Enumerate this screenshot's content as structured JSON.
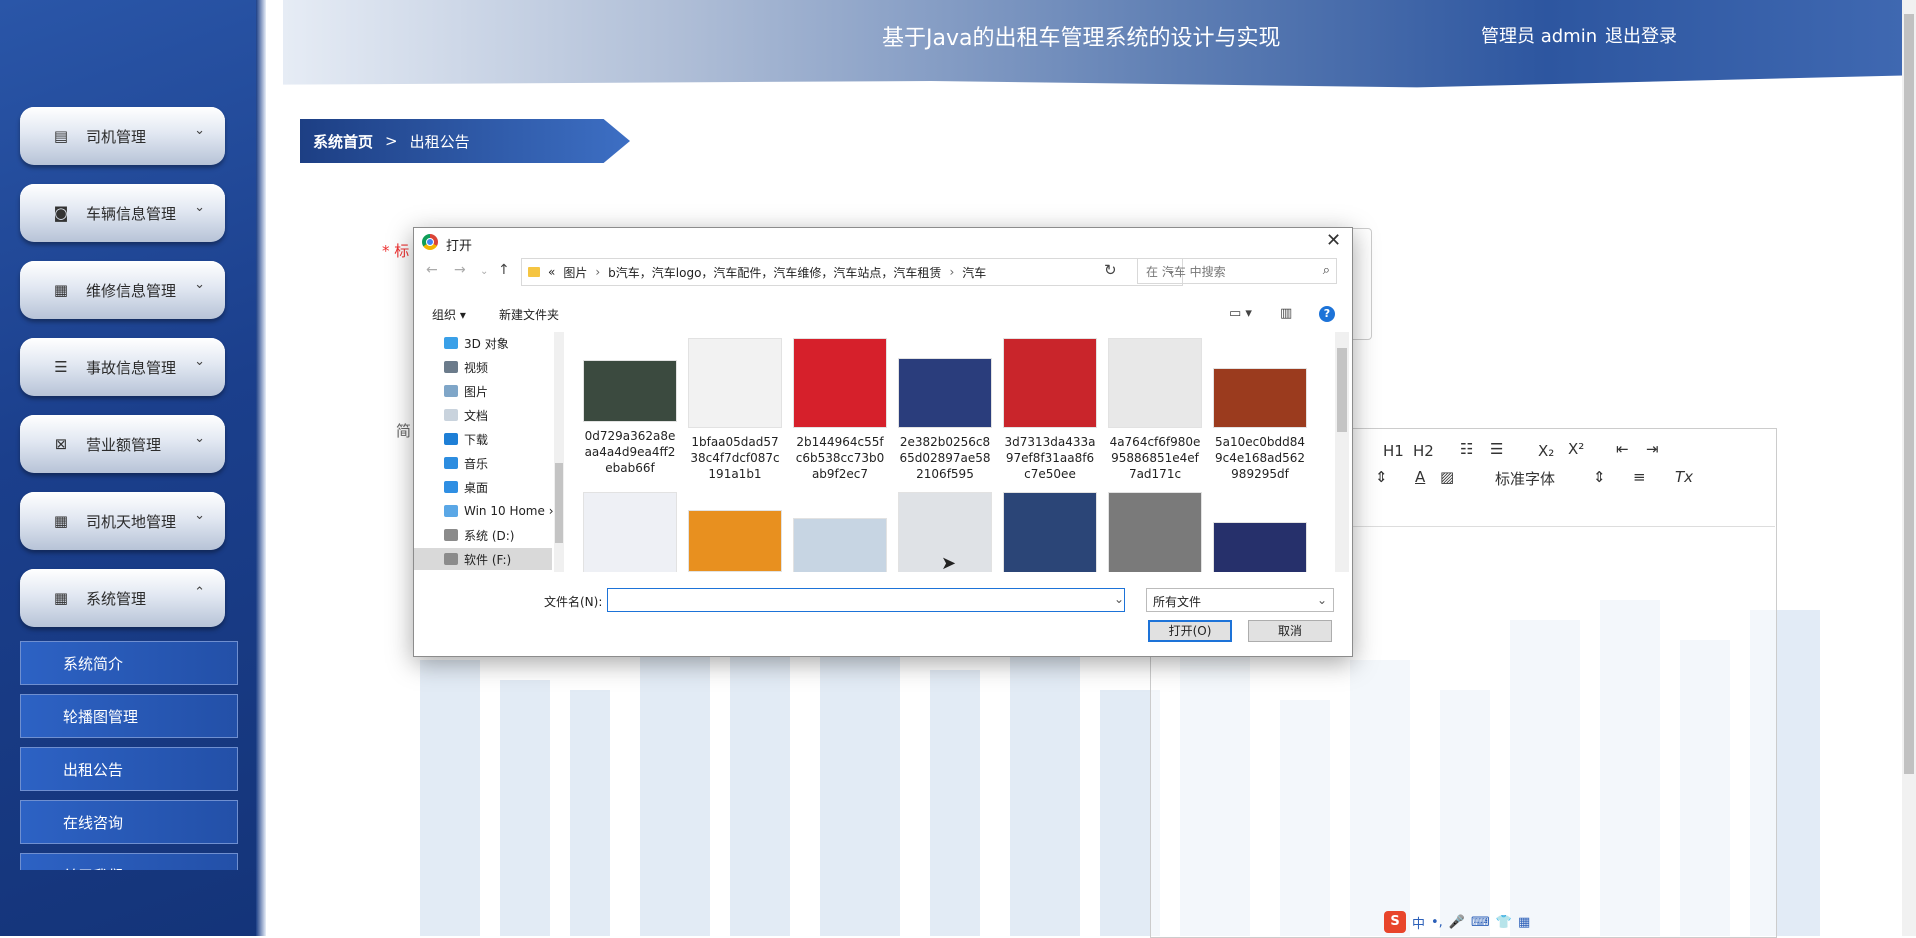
{
  "header": {
    "title": "基于Java的出租车管理系统的设计与实现",
    "user": "管理员 admin",
    "logout": "退出登录"
  },
  "sidebar": {
    "items": [
      {
        "label": "司机管理",
        "icon": "clipboard-icon",
        "chevron": "⌄"
      },
      {
        "label": "车辆信息管理",
        "icon": "briefcase-icon",
        "chevron": "⌄"
      },
      {
        "label": "维修信息管理",
        "icon": "grid-icon",
        "chevron": "⌄"
      },
      {
        "label": "事故信息管理",
        "icon": "list-icon",
        "chevron": "⌄"
      },
      {
        "label": "营业额管理",
        "icon": "clipboard-x-icon",
        "chevron": "⌄"
      },
      {
        "label": "司机天地管理",
        "icon": "grid-icon",
        "chevron": "⌄"
      },
      {
        "label": "系统管理",
        "icon": "grid-icon",
        "chevron": "⌃"
      }
    ],
    "sub_items": [
      "系统简介",
      "轮播图管理",
      "出租公告",
      "在线咨询",
      "关于我们"
    ]
  },
  "breadcrumb": {
    "home": "系统首页",
    "sep": ">",
    "current": "出租公告"
  },
  "form": {
    "title_label": "* 标",
    "summary_label": "简"
  },
  "editor": {
    "h1": "H1",
    "h2": "H2",
    "sub": "X₂",
    "sup": "X²",
    "font": "标准字体",
    "font_color": "A",
    "clear": "Tx"
  },
  "dialog": {
    "title": "打开",
    "close": "✕",
    "address": [
      "«",
      "图片",
      "›",
      "b汽车，汽车logo，汽车配件，汽车维修，汽车站点，汽车租赁",
      "›",
      "汽车"
    ],
    "search_placeholder": "在 汽车 中搜索",
    "organize": "组织 ▾",
    "new_folder": "新建文件夹",
    "nav": [
      "3D 对象",
      "视频",
      "图片",
      "文档",
      "下载",
      "音乐",
      "桌面",
      "Win 10 Home ›",
      "系统 (D:)",
      "软件 (F:)"
    ],
    "files": [
      {
        "name": "0d729a362a8eaa4a4d9ea4ff2ebab66f",
        "color": "#3b4a3f"
      },
      {
        "name": "1bfaa05dad5738c4f7dcf087c191a1b1",
        "color": "#f2f2f2"
      },
      {
        "name": "2b144964c55fc6b538cc73b0ab9f2ec7",
        "color": "#d6202b"
      },
      {
        "name": "2e382b0256c865d02897ae582106f595",
        "color": "#2a3d7c"
      },
      {
        "name": "3d7313da433a97ef8f31aa8f6c7e50ee",
        "color": "#c9252b"
      },
      {
        "name": "4a764cf6f980e95886851e4ef7ad171c",
        "color": "#e8e8e8"
      },
      {
        "name": "5a10ec0bdd849c4e168ad562989295df",
        "color": "#9b3b1e"
      },
      {
        "name": "",
        "color": "#eef0f5"
      },
      {
        "name": "",
        "color": "#e8901f"
      },
      {
        "name": "",
        "color": "#c7d5e3"
      },
      {
        "name": "",
        "color": "#dfe2e6"
      },
      {
        "name": "",
        "color": "#2b4577"
      },
      {
        "name": "",
        "color": "#7a7a7a"
      },
      {
        "name": "",
        "color": "#26306b"
      }
    ],
    "filename_label": "文件名(N):",
    "filename_value": "",
    "filetype": "所有文件",
    "open": "打开(O)",
    "cancel": "取消"
  },
  "ime": {
    "logo": "S",
    "items": [
      "中",
      "•,",
      "🎤",
      "⌨",
      "👕",
      "▦"
    ]
  }
}
